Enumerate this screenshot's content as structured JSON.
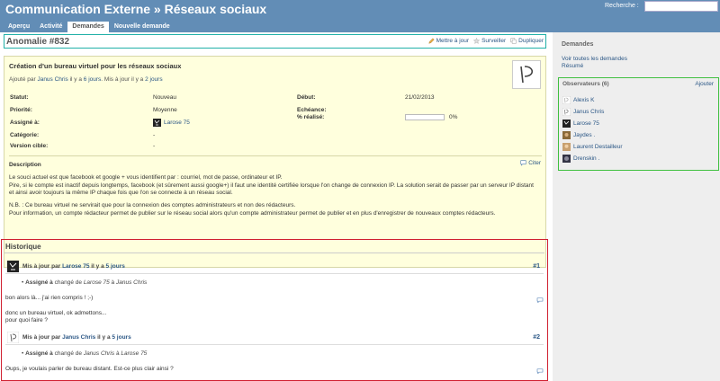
{
  "header": {
    "project_title": "Communication Externe » Réseaux sociaux",
    "search_label": "Recherche :",
    "search_value": ""
  },
  "tabs": [
    {
      "label": "Aperçu"
    },
    {
      "label": "Activité"
    },
    {
      "label": "Demandes"
    },
    {
      "label": "Nouvelle demande"
    }
  ],
  "issue": {
    "title": "Anomalie #832",
    "actions": {
      "edit": "Mettre à jour",
      "watch": "Surveiller",
      "copy": "Dupliquer"
    },
    "subject": "Création d'un bureau virtuel pour les réseaux sociaux",
    "author_prefix": "Ajouté par",
    "author": "Janus Chris",
    "added_ago_prefix": "il y a",
    "added_ago": "6 jours",
    "updated_prefix": ". Mis à jour il y a",
    "updated_ago": "2 jours",
    "attributes": {
      "status_label": "Statut:",
      "status": "Nouveau",
      "start_label": "Début:",
      "start": "21/02/2013",
      "priority_label": "Priorité:",
      "priority": "Moyenne",
      "due_label": "Echéance:",
      "due": "",
      "assigned_label": "Assigné à:",
      "assigned": "Larose 75",
      "done_label": "% réalisé:",
      "done": "0%",
      "done_ratio": 0,
      "category_label": "Catégorie:",
      "category": "-",
      "version_label": "Version cible:",
      "version": "-"
    },
    "description_title": "Description",
    "cite_label": "Citer",
    "description": [
      "Le souci actuel est que facebook et google + vous identifient par : courriel, mot de passe, ordinateur et IP.",
      "Pire, si le compte est inactif depuis longtemps, facebook (et sûrement aussi google+) il faut une identité certifiée lorsque l'on change de connexion IP. La solution serait de passer par un serveur IP distant et ainsi avoir toujours la même IP chaque fois que l'on se connecte à un réseau social.",
      "N.B. : Ce bureau virtuel ne servirait que pour la connexion des comptes administrateurs et non des rédacteurs.",
      "Pour information, un compte rédacteur permet de publier sur le réseau social alors qu'un compte administrateur permet de publier et en plus d'enregistrer de nouveaux comptes rédacteurs."
    ]
  },
  "history": {
    "title": "Historique",
    "journals": [
      {
        "prefix": "Mis à jour par",
        "user": "Larose 75",
        "ago_prefix": "il y a",
        "ago": "5 jours",
        "number": "#1",
        "detail_field": "Assigné à",
        "detail_changed": "changé de",
        "detail_from": "Larose 75",
        "detail_to_word": "à",
        "detail_to": "Janus Chris",
        "notes": [
          "bon alors là... j'ai rien compris ! ;-)",
          "donc un bureau virtuel, ok admettons...",
          "pour quoi faire ?"
        ]
      },
      {
        "prefix": "Mis à jour par",
        "user": "Janus Chris",
        "ago_prefix": "il y a",
        "ago": "5 jours",
        "number": "#2",
        "detail_field": "Assigné à",
        "detail_changed": "changé de",
        "detail_from": "Janus Chris",
        "detail_to_word": "à",
        "detail_to": "Larose 75",
        "notes": [
          "Oups, je voulais parler de bureau distant. Est-ce plus clair ainsi ?"
        ]
      }
    ]
  },
  "sidebar": {
    "title": "Demandes",
    "link_all": "Voir toutes les demandes",
    "link_summary": "Résumé",
    "watchers_title": "Observateurs (6)",
    "watchers_add": "Ajouter",
    "watchers": [
      {
        "name": "Alexis K"
      },
      {
        "name": "Janus Chris"
      },
      {
        "name": "Larose 75"
      },
      {
        "name": "Jaydes ."
      },
      {
        "name": "Laurent Destailleur"
      },
      {
        "name": "Drenskin ."
      }
    ]
  },
  "colors": {
    "header": "#628db6",
    "link": "#2a5685",
    "issue_bg": "#ffffdd"
  }
}
